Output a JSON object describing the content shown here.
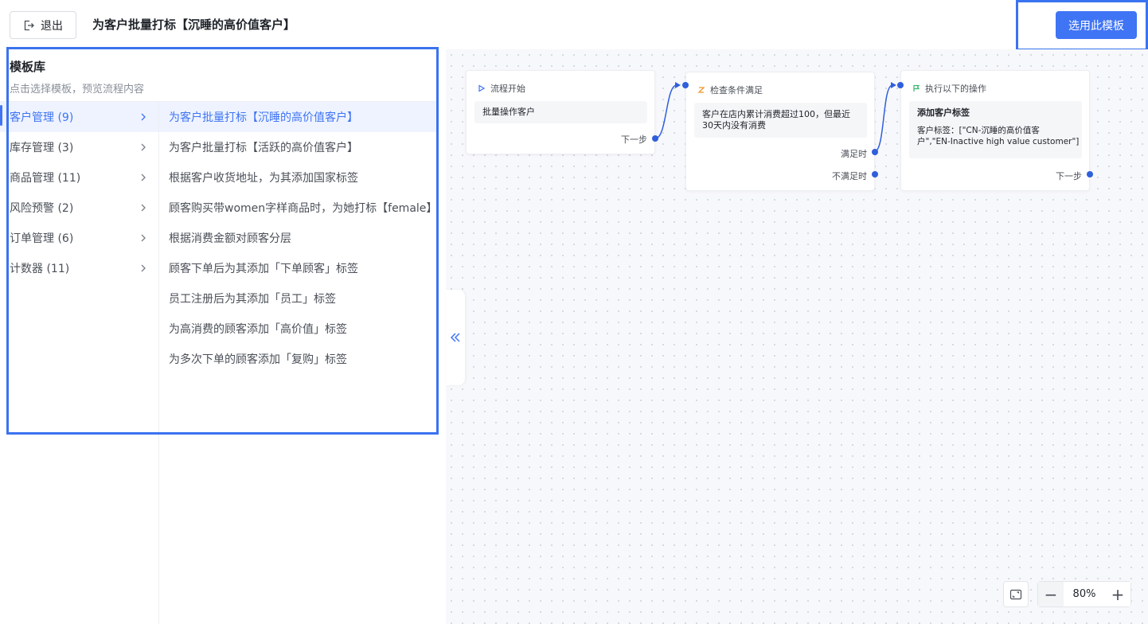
{
  "header": {
    "exit_label": "退出",
    "title": "为客户批量打标【沉睡的高价值客户】",
    "select_label": "选用此模板"
  },
  "library": {
    "title": "模板库",
    "subtitle": "点击选择模板，预览流程内容",
    "categories": [
      {
        "label": "客户管理 (9)",
        "active": true
      },
      {
        "label": "库存管理 (3)",
        "active": false
      },
      {
        "label": "商品管理 (11)",
        "active": false
      },
      {
        "label": "风险预警 (2)",
        "active": false
      },
      {
        "label": "订单管理 (6)",
        "active": false
      },
      {
        "label": "计数器 (11)",
        "active": false
      }
    ],
    "templates": [
      {
        "label": "为客户批量打标【沉睡的高价值客户】",
        "active": true
      },
      {
        "label": "为客户批量打标【活跃的高价值客户】",
        "active": false
      },
      {
        "label": "根据客户收货地址，为其添加国家标签",
        "active": false
      },
      {
        "label": "顾客购买带women字样商品时，为她打标【female】",
        "active": false
      },
      {
        "label": "根据消费金额对顾客分层",
        "active": false
      },
      {
        "label": "顾客下单后为其添加「下单顾客」标签",
        "active": false
      },
      {
        "label": "员工注册后为其添加「员工」标签",
        "active": false
      },
      {
        "label": "为高消费的顾客添加「高价值」标签",
        "active": false
      },
      {
        "label": "为多次下单的顾客添加「复购」标签",
        "active": false
      }
    ]
  },
  "flow": {
    "start": {
      "header": "流程开始",
      "body": "批量操作客户",
      "next": "下一步"
    },
    "condition": {
      "header": "检查条件满足",
      "body_line1": "客户在店内累计消费超过100，但最近",
      "body_line2": "30天内没有消费",
      "yes": "满足时",
      "no": "不满足时"
    },
    "action": {
      "header": "执行以下的操作",
      "title": "添加客户标签",
      "detail_line1": "客户标签：[\"CN-沉睡的高价值客",
      "detail_line2": "户\",\"EN-Inactive high value customer\"]",
      "next": "下一步"
    }
  },
  "zoom": {
    "value": "80%",
    "minus": "−",
    "plus": "+"
  },
  "icons": {
    "exit": "exit-icon",
    "collapse": "double-chevron-left-icon",
    "fit": "fit-view-icon"
  },
  "colors": {
    "accent": "#3f74f5",
    "connector": "#2f5fdb",
    "highlight": "#3a73f0"
  }
}
